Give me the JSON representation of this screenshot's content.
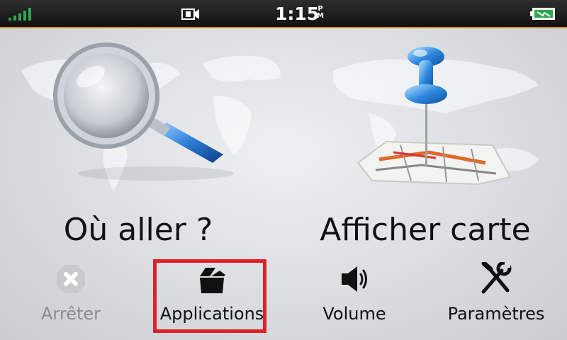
{
  "status_bar": {
    "time": "1:15",
    "ampm_top": "P",
    "ampm_bottom": "M",
    "signal_icon": "signal-bars-icon",
    "video_icon": "video-camera-icon",
    "battery_icon": "battery-charging-icon"
  },
  "main": {
    "where_to": {
      "label": "Où aller ?",
      "icon": "magnifying-glass-icon"
    },
    "view_map": {
      "label": "Afficher carte",
      "icon": "map-pin-icon"
    }
  },
  "bottom_bar": {
    "stop": {
      "label": "Arrêter",
      "icon": "stop-x-icon",
      "enabled": false
    },
    "apps": {
      "label": "Applications",
      "icon": "open-box-icon"
    },
    "volume": {
      "label": "Volume",
      "icon": "speaker-icon"
    },
    "settings": {
      "label": "Paramètres",
      "icon": "wrench-screwdriver-icon"
    }
  },
  "colors": {
    "accent_orange": "#e08a1e",
    "signal_green": "#2fa84f",
    "highlight_red": "#e02028",
    "disabled_gray": "#8c8c8c"
  }
}
